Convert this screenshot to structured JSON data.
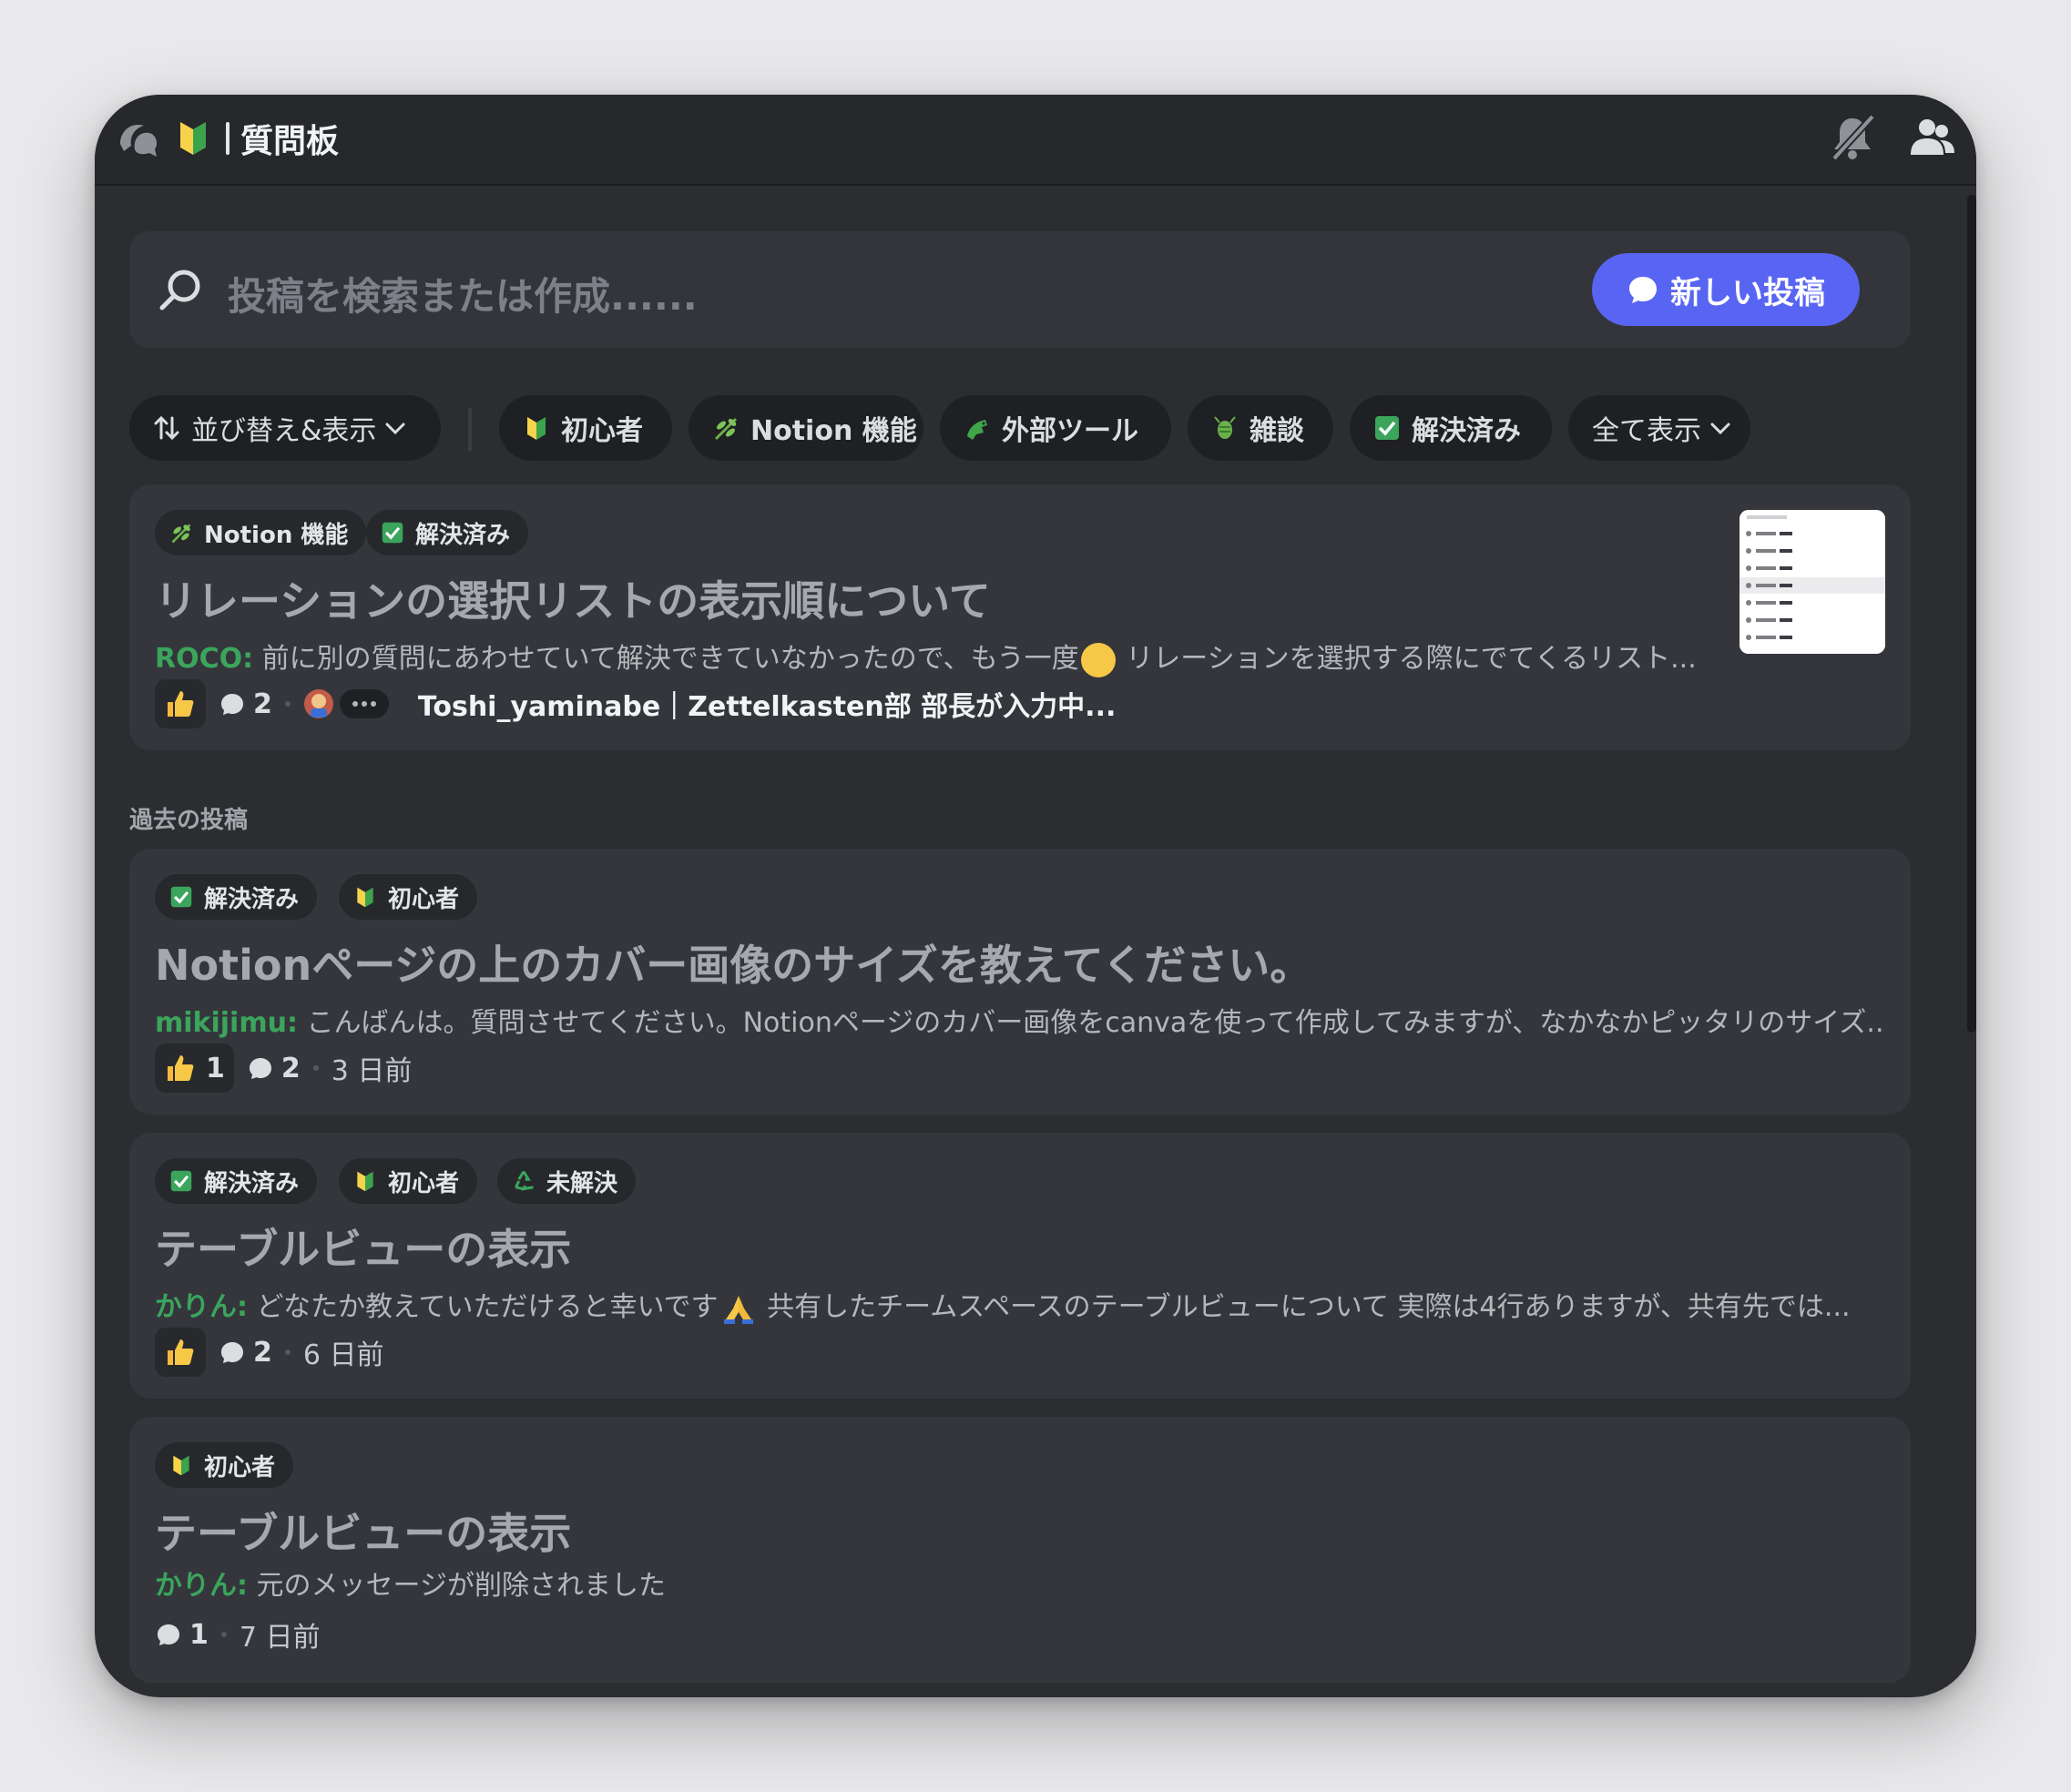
{
  "header": {
    "channel_name": "質問板",
    "forum_icon": "forum-icon",
    "beginner_icon": "beginner-mark-icon"
  },
  "search": {
    "placeholder": "投稿を検索または作成......",
    "new_post_label": "新しい投稿"
  },
  "filters": {
    "sort_label": "並び替え&表示",
    "chips": [
      "初心者",
      "Notion 機能",
      "外部ツール",
      "雑談",
      "解決済み"
    ],
    "show_all_label": "全て表示"
  },
  "colors": {
    "accent": "#5865f2",
    "author": "#3ba55c",
    "background": "#2b2d31",
    "card": "#34363c"
  },
  "posts": [
    {
      "tags": [
        "Notion 機能",
        "解決済み"
      ],
      "title": "リレーションの選択リストの表示順について",
      "author": "ROCO",
      "preview_a": "前に別の質問にあわせていて解決できていなかったので、もう一度",
      "preview_b": "リレーションを選択する際にでてくるリスト...",
      "comments": "2",
      "typing": "Toshi_yaminabe｜Zettelkasten部 部長が入力中..."
    }
  ],
  "past_section_label": "過去の投稿",
  "past_posts": [
    {
      "tags": [
        "解決済み",
        "初心者"
      ],
      "title": "Notionページの上のカバー画像のサイズを教えてください。",
      "author": "mikijimu",
      "preview": "こんばんは。質問させてください。Notionページのカバー画像をcanvaを使って作成してみますが、なかなかピッタリのサイズ...",
      "likes": "1",
      "comments": "2",
      "time": "3 日前"
    },
    {
      "tags": [
        "解決済み",
        "初心者",
        "未解決"
      ],
      "title": "テーブルビューの表示",
      "author": "かりん",
      "preview_a": "どなたか教えていただけると幸いです",
      "preview_b": "共有したチームスペースのテーブルビューについて 実際は4行ありますが、共有先では...",
      "comments": "2",
      "time": "6 日前"
    },
    {
      "tags": [
        "初心者"
      ],
      "title": "テーブルビューの表示",
      "author": "かりん",
      "preview": "元のメッセージが削除されました",
      "comments": "1",
      "time": "7 日前"
    }
  ]
}
